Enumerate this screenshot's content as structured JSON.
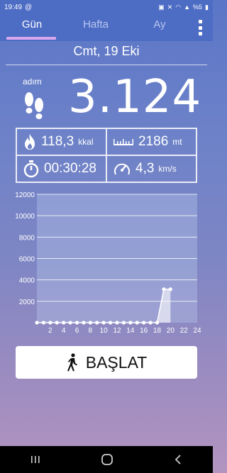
{
  "status": {
    "time": "19:49",
    "battery": "%5"
  },
  "tabs": [
    {
      "label": "Gün",
      "active": true
    },
    {
      "label": "Hafta",
      "active": false
    },
    {
      "label": "Ay",
      "active": false
    }
  ],
  "date": "Cmt, 19 Eki",
  "steps": {
    "label": "adım",
    "value": "3.124"
  },
  "stats": {
    "calories": {
      "value": "118,3",
      "unit": "kkal",
      "icon": "flame-icon"
    },
    "distance": {
      "value": "2186",
      "unit": "mt",
      "icon": "ruler-icon"
    },
    "duration": {
      "value": "00:30:28",
      "icon": "stopwatch-icon"
    },
    "speed": {
      "value": "4,3",
      "unit": "km/s",
      "icon": "speedometer-icon"
    }
  },
  "chart_data": {
    "type": "area",
    "x": [
      0,
      1,
      2,
      3,
      4,
      5,
      6,
      7,
      8,
      9,
      10,
      11,
      12,
      13,
      14,
      15,
      16,
      17,
      18,
      19,
      20
    ],
    "values": [
      0,
      0,
      0,
      0,
      0,
      0,
      0,
      0,
      0,
      0,
      0,
      0,
      0,
      0,
      0,
      0,
      0,
      0,
      0,
      3124,
      3124
    ],
    "xticks": [
      2,
      4,
      6,
      8,
      10,
      12,
      14,
      16,
      18,
      20,
      22,
      24
    ],
    "yticks": [
      2000,
      4000,
      6000,
      8000,
      10000,
      12000
    ],
    "xlim": [
      0,
      24
    ],
    "ylim": [
      0,
      12000
    ],
    "grid": true
  },
  "start_button": {
    "label": "BAŞLAT",
    "icon": "walking-person-icon"
  },
  "navbar": {
    "recent": "recent-apps-icon",
    "home": "home-icon",
    "back": "back-icon"
  }
}
